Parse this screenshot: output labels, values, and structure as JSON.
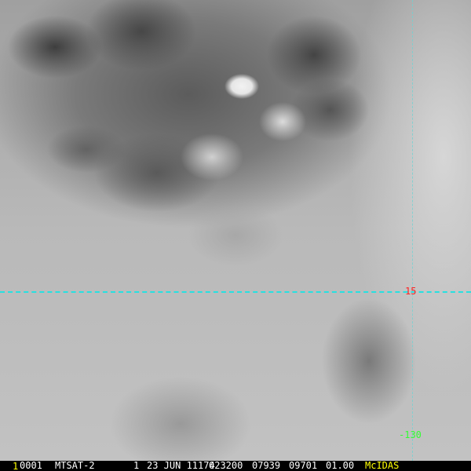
{
  "overlay": {
    "latitude_label": "15",
    "longitude_label": "-130",
    "colors": {
      "grid": "#27e0e0",
      "lat_label": "#ff2020",
      "lon_label": "#30ff30",
      "brand": "#ffff00"
    }
  },
  "status_bar": {
    "frame_number": "1",
    "id": "0001",
    "satellite": "MTSAT-2",
    "band": "1",
    "date": "23 JUN 11174",
    "time": "023200",
    "line": "07939",
    "element": "09701",
    "resolution": "01.00",
    "brand": "McIDAS"
  }
}
